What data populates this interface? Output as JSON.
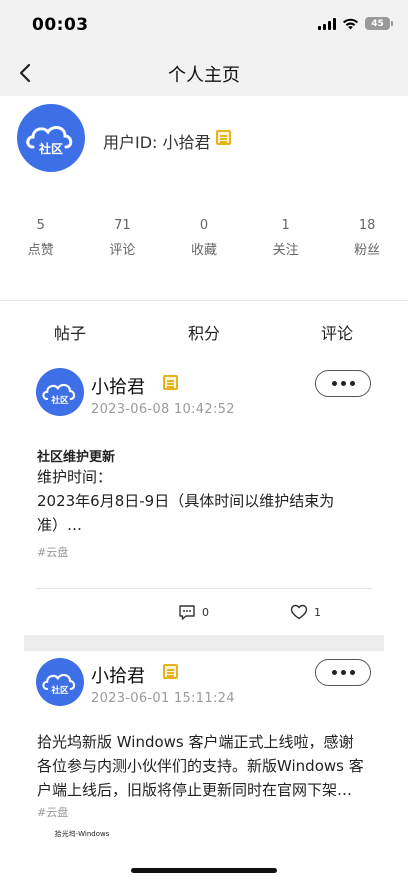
{
  "status_bar": {
    "time": "00:03",
    "battery": "45"
  },
  "nav": {
    "title": "个人主页"
  },
  "profile": {
    "avatar_text": "社区",
    "user_id_label": "用户ID: 小拾君",
    "stats": [
      {
        "value": "5",
        "label": "点赞"
      },
      {
        "value": "71",
        "label": "评论"
      },
      {
        "value": "0",
        "label": "收藏"
      },
      {
        "value": "1",
        "label": "关注"
      },
      {
        "value": "18",
        "label": "粉丝"
      }
    ]
  },
  "tabs": [
    "帖子",
    "积分",
    "评论"
  ],
  "posts": [
    {
      "avatar_text": "社区",
      "author": "小拾君",
      "time": "2023-06-08 10:42:52",
      "title": "社区维护更新",
      "body_lines": [
        "维护时间：",
        "2023年6月8日-9日（具体时间以维护结束为",
        "准）…"
      ],
      "tag": "#云盘",
      "comment_count": "0",
      "like_count": "1"
    },
    {
      "avatar_text": "社区",
      "author": "小拾君",
      "time": "2023-06-01 15:11:24",
      "body_lines": [
        "拾光坞新版 Windows 客户端正式上线啦，感谢",
        "各位参与内测小伙伴们的支持。新版Windows 客",
        "户端上线后，旧版将停止更新同时在官网下架…"
      ],
      "tag": "#云盘",
      "thumbnail_text": "拾光坞-Windows"
    }
  ]
}
